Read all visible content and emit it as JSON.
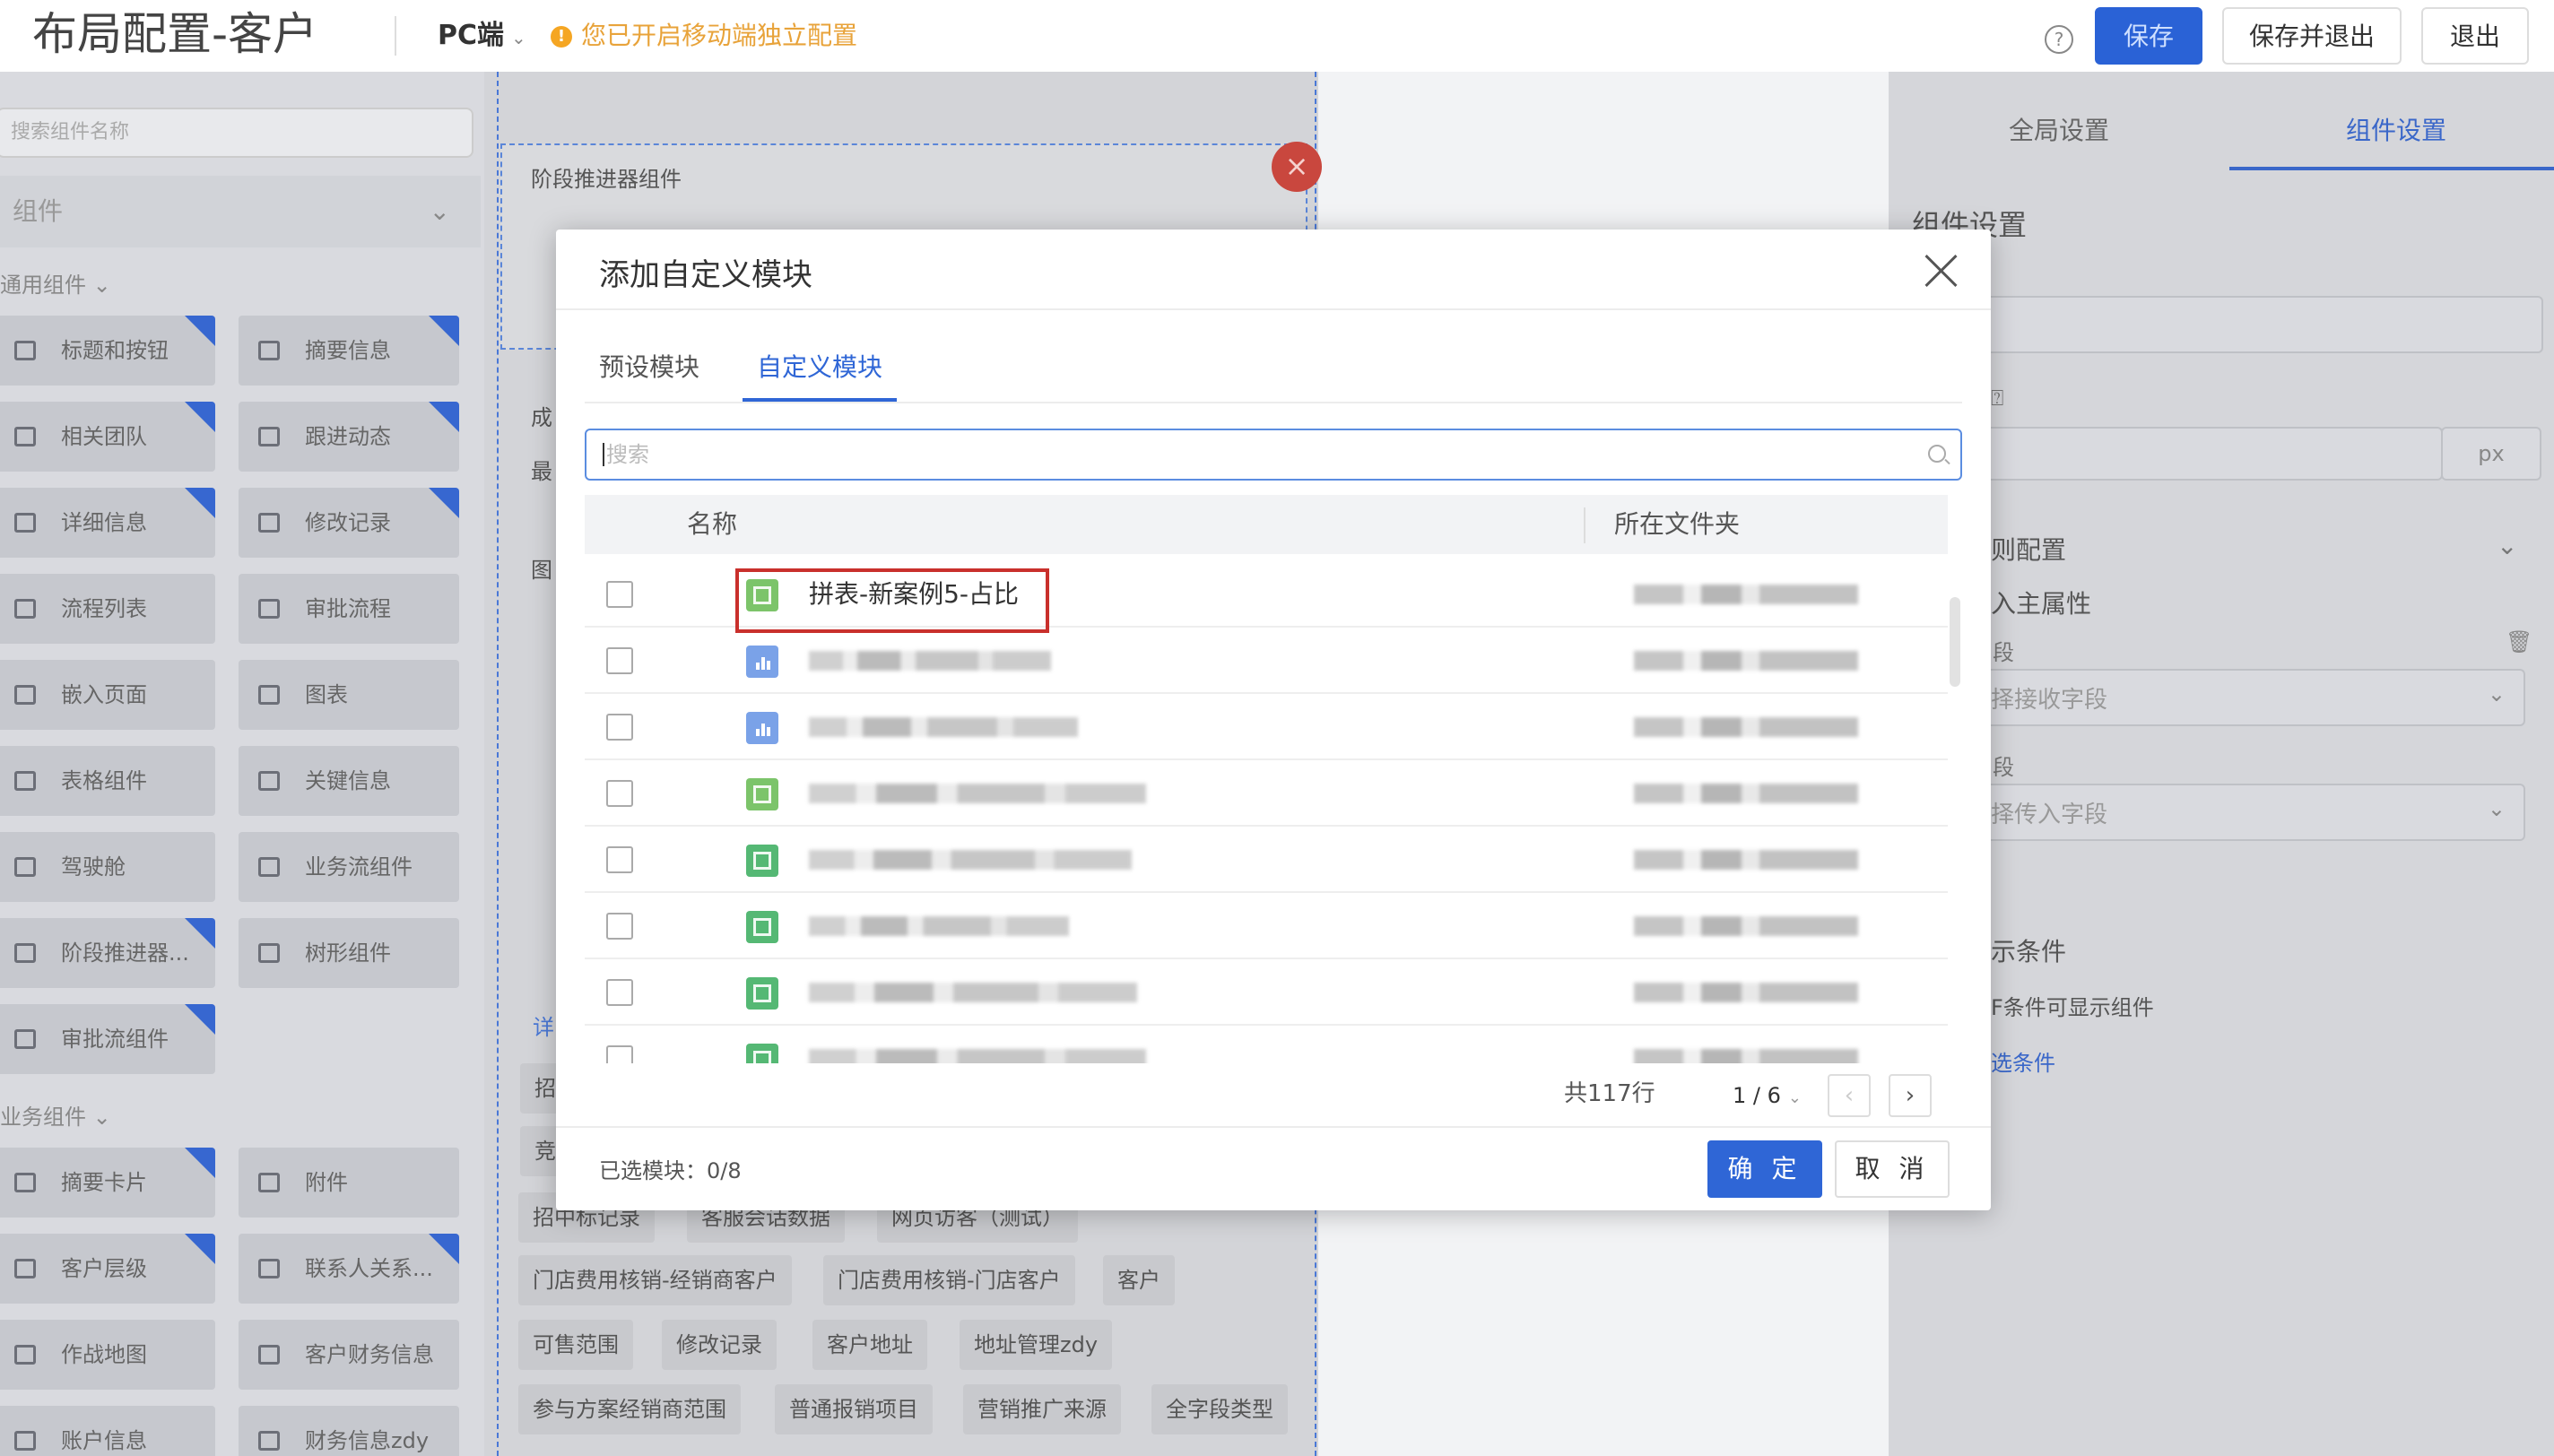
{
  "header": {
    "title": "布局配置-客户",
    "platform": "PC端",
    "notice": "您已开启移动端独立配置",
    "help_icon": "?",
    "save": "保存",
    "save_exit": "保存并退出",
    "exit": "退出"
  },
  "left": {
    "search_placeholder": "搜索组件名称",
    "select": "组件",
    "cat_general": "通用组件",
    "cat_business": "业务组件",
    "general_items": [
      "标题和按钮",
      "摘要信息",
      "相关团队",
      "跟进动态",
      "详细信息",
      "修改记录",
      "流程列表",
      "审批流程",
      "嵌入页面",
      "图表",
      "表格组件",
      "关键信息",
      "驾驶舱",
      "业务流组件",
      "阶段推进器...",
      "树形组件",
      "审批流组件"
    ],
    "business_items": [
      "摘要卡片",
      "附件",
      "客户层级",
      "联系人关系...",
      "作战地图",
      "客户财务信息",
      "账户信息",
      "财务信息zdy"
    ]
  },
  "canvas": {
    "stage_title": "阶段推进器组件",
    "close": "×",
    "frag_1": "成",
    "frag_2": "最",
    "frag_3": "图",
    "frag_4": "详",
    "frag_5": "招",
    "frag_6": "竞",
    "tags": [
      "招中标记录",
      "客服会话数据",
      "网页访客（测试）",
      "门店费用核销-经销商客户",
      "门店费用核销-门店客户",
      "客户",
      "可售范围",
      "修改记录",
      "客户地址",
      "地址管理zdy",
      "参与方案经销商范围",
      "普通报销项目",
      "营销推广来源",
      "全字段类型"
    ]
  },
  "right": {
    "tab_global": "全局设置",
    "tab_component": "组件设置",
    "section_title": "组件设置",
    "px": "px",
    "rule_config": "则配置",
    "main_prop": "入主属性",
    "field_1": "段",
    "field_1_placeholder": "择接收字段",
    "field_2": "段",
    "field_2_placeholder": "择传入字段",
    "display_cond": "示条件",
    "display_desc": "F条件可显示组件",
    "select_cond": "选条件"
  },
  "modal": {
    "title": "添加自定义模块",
    "tab_preset": "预设模块",
    "tab_custom": "自定义模块",
    "search_placeholder": "搜索",
    "col_name": "名称",
    "col_folder": "所在文件夹",
    "first_row_name": "拼表-新案例5-占比",
    "total": "共117行",
    "page": "1 / 6",
    "selected": "已选模块：0/8",
    "confirm": "确 定",
    "cancel": "取 消"
  }
}
